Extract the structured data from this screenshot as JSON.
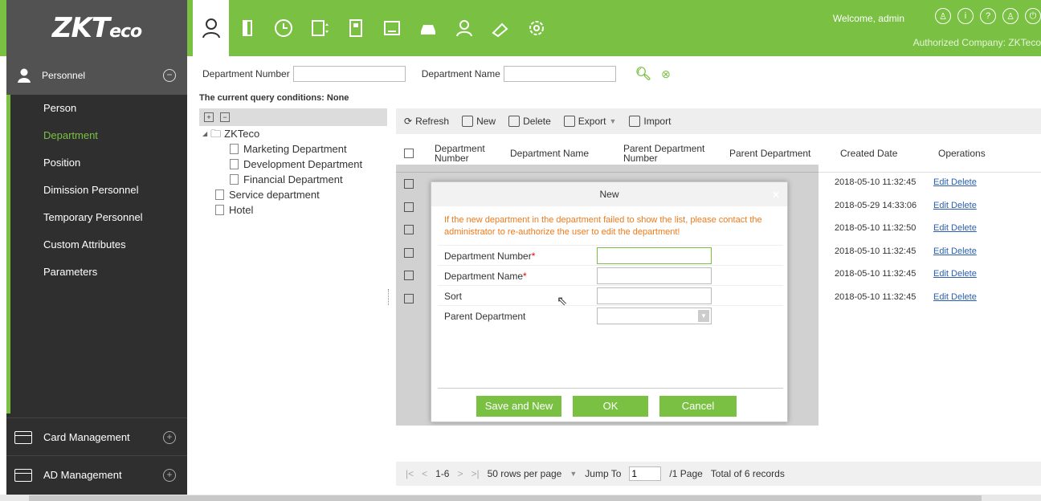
{
  "brand": {
    "logo": "ZKT",
    "logo_suffix": "eco",
    "accent": "#7ac143"
  },
  "header": {
    "welcome": "Welcome, admin",
    "company": "Authorized Company: ZKTeco",
    "modules": [
      "personnel-icon",
      "door-icon",
      "clock-icon",
      "elevator-icon",
      "building-icon",
      "id-card-icon",
      "car-icon",
      "guard-icon",
      "patrol-icon",
      "settings-icon"
    ]
  },
  "sidebar": {
    "section": "Personnel",
    "items": [
      {
        "label": "Person"
      },
      {
        "label": "Department"
      },
      {
        "label": "Position"
      },
      {
        "label": "Dimission Personnel"
      },
      {
        "label": "Temporary Personnel"
      },
      {
        "label": "Custom Attributes"
      },
      {
        "label": "Parameters"
      }
    ],
    "card_management": "Card Management",
    "ad_management": "AD Management"
  },
  "search": {
    "dept_number_label": "Department Number",
    "dept_name_label": "Department Name",
    "query_conditions": "The current query conditions: None"
  },
  "tree": {
    "root": "ZKTeco",
    "children": [
      "Marketing Department",
      "Development Department",
      "Financial Department"
    ],
    "siblings": [
      "Service department",
      "Hotel"
    ]
  },
  "toolbar": {
    "refresh": "Refresh",
    "new": "New",
    "delete": "Delete",
    "export": "Export",
    "import": "Import"
  },
  "grid": {
    "headers": {
      "dept_number": "Department Number",
      "dept_name": "Department Name",
      "parent_number": "Parent Department Number",
      "parent_name": "Parent Department",
      "created": "Created Date",
      "operations": "Operations"
    },
    "rows": [
      {
        "created": "2018-05-10 11:32:45",
        "ops": "Edit Delete"
      },
      {
        "created": "2018-05-29 14:33:06",
        "ops": "Edit Delete"
      },
      {
        "created": "2018-05-10 11:32:50",
        "ops": "Edit Delete"
      },
      {
        "created": "2018-05-10 11:32:45",
        "ops": "Edit Delete"
      },
      {
        "created": "2018-05-10 11:32:45",
        "ops": "Edit Delete"
      },
      {
        "created": "2018-05-10 11:32:45",
        "ops": "Edit Delete"
      }
    ]
  },
  "pager": {
    "range": "1-6",
    "rows_per_page": "50 rows per page",
    "jump_label": "Jump To",
    "jump_value": "1",
    "pages": "/1 Page",
    "total": "Total of 6 records"
  },
  "modal": {
    "title": "New",
    "close": "×",
    "message": "If the new department in the department failed to show the list, please contact the administrator to re-authorize the user to edit the department!",
    "fields": {
      "dept_number": "Department Number",
      "dept_name": "Department Name",
      "sort": "Sort",
      "parent": "Parent Department"
    },
    "required_mark": "*",
    "buttons": {
      "save_new": "Save and New",
      "ok": "OK",
      "cancel": "Cancel"
    }
  }
}
